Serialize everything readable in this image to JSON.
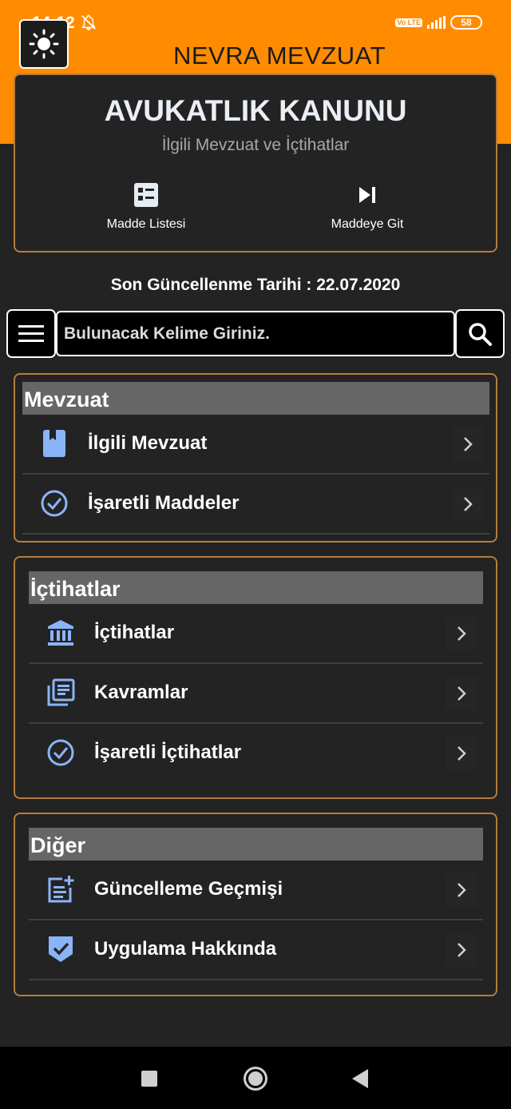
{
  "status_bar": {
    "time": "14:12",
    "volte": "Vo LTE",
    "battery": "58"
  },
  "app": {
    "title": "NEVRA MEVZUAT"
  },
  "header": {
    "title": "AVUKATLIK KANUNU",
    "subtitle": "İlgili Mevzuat ve İçtihatlar",
    "actions": [
      {
        "label": "Madde Listesi",
        "icon": "list-icon"
      },
      {
        "label": "Maddeye Git",
        "icon": "skip-next-icon"
      }
    ]
  },
  "last_updated": "Son Güncellenme Tarihi : 22.07.2020",
  "search": {
    "placeholder": "Bulunacak Kelime Giriniz."
  },
  "sections": [
    {
      "title": "Mevzuat",
      "items": [
        {
          "label": "İlgili Mevzuat",
          "icon": "book-icon"
        },
        {
          "label": "İşaretli Maddeler",
          "icon": "check-circle-icon"
        }
      ]
    },
    {
      "title": "İçtihatlar",
      "items": [
        {
          "label": "İçtihatlar",
          "icon": "courthouse-icon"
        },
        {
          "label": "Kavramlar",
          "icon": "library-books-icon"
        },
        {
          "label": "İşaretli İçtihatlar",
          "icon": "check-circle-icon"
        }
      ]
    },
    {
      "title": "Diğer",
      "items": [
        {
          "label": "Güncelleme Geçmişi",
          "icon": "note-add-icon"
        },
        {
          "label": "Uygulama Hakkında",
          "icon": "verified-icon"
        }
      ]
    }
  ],
  "colors": {
    "accent": "#ff8c00",
    "card_border": "#b87b3c",
    "icon_blue": "#8ab4f8",
    "background": "#232323"
  }
}
